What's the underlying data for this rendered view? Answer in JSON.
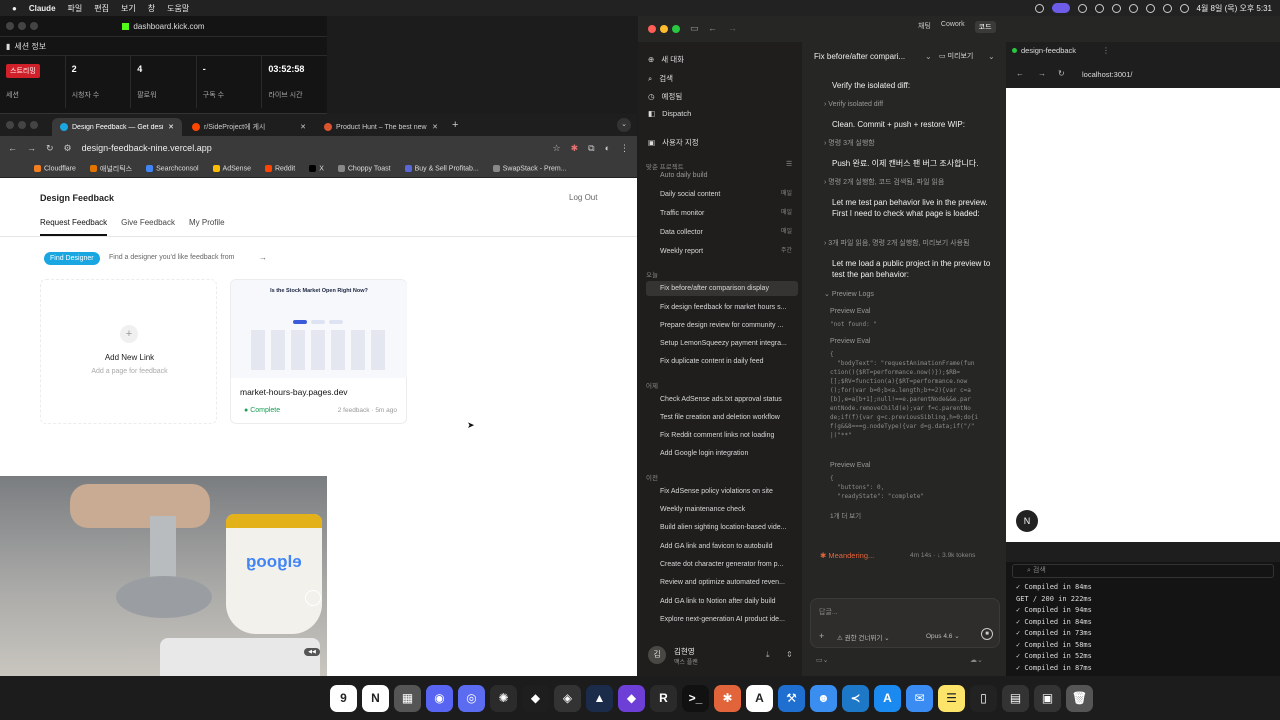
{
  "menubar": {
    "app": "Claude",
    "items": [
      "파일",
      "편집",
      "보기",
      "창",
      "도움말"
    ],
    "datetime": "4월 8일 (목) 오후 5:31"
  },
  "kick": {
    "url": "dashboard.kick.com",
    "header": "세션 정보",
    "live_badge": "스트리밍",
    "stats": [
      {
        "value": "",
        "label": "세션"
      },
      {
        "value": "2",
        "label": "시청자 수"
      },
      {
        "value": "4",
        "label": "팔로워"
      },
      {
        "value": "-",
        "label": "구독 수"
      },
      {
        "value": "03:52:58",
        "label": "라이브 시간"
      }
    ]
  },
  "chrome": {
    "tabs": [
      {
        "label": "Design Feedback — Get desi",
        "color": "#1aa6e0"
      },
      {
        "label": "r/SideProject에 게시",
        "color": "#ff4500"
      },
      {
        "label": "Product Hunt – The best new",
        "color": "#da552f"
      }
    ],
    "url": "design-feedback-nine.vercel.app",
    "bookmarks": [
      {
        "label": "Cloudflare",
        "color": "#f38020"
      },
      {
        "label": "애널리틱스",
        "color": "#e37400"
      },
      {
        "label": "Searchconsol",
        "color": "#4285f4"
      },
      {
        "label": "AdSense",
        "color": "#fbbc04"
      },
      {
        "label": "Reddit",
        "color": "#ff4500"
      },
      {
        "label": "X",
        "color": "#000000"
      },
      {
        "label": "Choppy Toast",
        "color": "#888888"
      },
      {
        "label": "Buy & Sell Profitab...",
        "color": "#5a67d8"
      },
      {
        "label": "SwapStack - Prem...",
        "color": "#888888"
      }
    ]
  },
  "page": {
    "brand": "Design Feedback",
    "logout": "Log Out",
    "nav": [
      "Request Feedback",
      "Give Feedback",
      "My Profile"
    ],
    "find_button": "Find Designer",
    "find_hint": "Find a designer you'd like feedback from",
    "find_arrow": "→",
    "add_card": {
      "title": "Add New Link",
      "subtitle": "Add a page for feedback"
    },
    "project_card": {
      "preview_title": "Is the Stock Market Open Right Now?",
      "name": "market-hours-bay.pages.dev",
      "status": "Complete",
      "meta": "2 feedback · 5m ago"
    }
  },
  "claude": {
    "mode_tabs": [
      "채팅",
      "Cowork",
      "코드"
    ],
    "sidebar": {
      "new_chat": "새 대화",
      "search": "검색",
      "scheduled": "예정됨",
      "dispatch": "Dispatch",
      "custom": "사용자 지정",
      "projects_label": "맞춘 프로젝트",
      "recurring": [
        {
          "title": "Auto daily build",
          "meta": ""
        },
        {
          "title": "Daily social content",
          "meta": "매일"
        },
        {
          "title": "Traffic monitor",
          "meta": "매일"
        },
        {
          "title": "Data collector",
          "meta": "매일"
        },
        {
          "title": "Weekly report",
          "meta": "주간"
        }
      ],
      "today_label": "오늘",
      "today": [
        "Fix before/after comparison display",
        "Fix design feedback for market hours s...",
        "Prepare design review for community ...",
        "Setup LemonSqueezy payment integra...",
        "Fix duplicate content in daily feed"
      ],
      "yesterday_label": "어제",
      "yesterday": [
        "Check AdSense ads.txt approval status",
        "Test file creation and deletion workflow",
        "Fix Reddit comment links not loading",
        "Add Google login integration"
      ],
      "older_label": "이전",
      "older": [
        "Fix AdSense policy violations on site",
        "Weekly maintenance check",
        "Build alien sighting location-based vide...",
        "Add GA link and favicon to autobuild",
        "Create dot character generator from p...",
        "Review and optimize automated reven...",
        "Add GA link to Notion after daily build",
        "Explore next-generation AI product ide..."
      ],
      "user_name": "김현영",
      "user_plan": "맥스 플랜",
      "user_initial": "김"
    },
    "chat": {
      "title": "Fix before/after compari...",
      "preview_btn": "미리보기",
      "lines": [
        {
          "kind": "bold",
          "text": "Verify the isolated diff:"
        },
        {
          "kind": "dim",
          "text": "Verify isolated diff"
        },
        {
          "kind": "bold",
          "text": "Clean. Commit + push + restore WIP:"
        },
        {
          "kind": "dim",
          "text": "명령 3개 실행함"
        },
        {
          "kind": "bold",
          "text": "Push 완료. 이제 캔버스 팬 버그 조사합니다."
        },
        {
          "kind": "dim",
          "text": "명령 2개 실행함, 코드 검색됨, 파일 읽음"
        },
        {
          "kind": "bold",
          "text": "Let me test pan behavior live in the preview. First I need to check what page is loaded:"
        },
        {
          "kind": "dim",
          "text": "3개 파일 읽음, 명령 2개 실행함, 미리보기 사용됨"
        },
        {
          "kind": "bold",
          "text": "Let me load a public project in the preview to test the pan behavior:"
        },
        {
          "kind": "dim",
          "text": "Preview Logs"
        }
      ],
      "eval1_label": "Preview Eval",
      "eval1_code": "\"not found: \"",
      "eval2_label": "Preview Eval",
      "eval2_code": "{\n  \"bodyText\": \"requestAnimationFrame(fun\nction(){$RT=performance.now()});$RB=\n[];$RV=function(a){$RT=performance.now\n();for(var b=0;b<a.length;b+=2){var c=a\n[b],e=a[b+1];null!==e.parentNode&&e.par\nentNode.removeChild(e);var f=c.parentNo\nde;if(f){var g=c.previousSibling,h=0;do{i\nf(g&&8===g.nodeType){var d=g.data;if(\"/\"\n|(\"**\"",
      "eval3_label": "Preview Eval",
      "eval3_code": "{\n  \"buttons\": 0,\n  \"readyState\": \"complete\"",
      "more": "1개 더 보기",
      "status": "Meandering...",
      "status_meta": "4m 14s · ↓ 3.9k tokens",
      "reply_placeholder": "답글...",
      "permission": "권한 건너뛰기",
      "model": "Opus 4.6"
    },
    "preview": {
      "tab": "design-feedback",
      "url": "localhost:3001/",
      "avatar_letter": "N",
      "console_search": "검색",
      "console": [
        "✓ Compiled in 84ms",
        "GET / 200 in 222ms",
        "✓ Compiled in 94ms",
        "✓ Compiled in 84ms",
        "✓ Compiled in 73ms",
        "✓ Compiled in 58ms",
        "✓ Compiled in 52ms",
        "✓ Compiled in 87ms"
      ]
    }
  },
  "dock": [
    {
      "name": "calendar",
      "glyph": "9",
      "color": "#ffffff"
    },
    {
      "name": "notion",
      "glyph": "N",
      "color": "#ffffff"
    },
    {
      "name": "calculator",
      "glyph": "▦",
      "color": "#555555"
    },
    {
      "name": "discord",
      "glyph": "◉",
      "color": "#5865f2"
    },
    {
      "name": "messenger",
      "glyph": "◎",
      "color": "#5b6cf0"
    },
    {
      "name": "chatgpt",
      "glyph": "✺",
      "color": "#2b2b2b"
    },
    {
      "name": "figma",
      "glyph": "◆",
      "color": "#1e1e1e"
    },
    {
      "name": "cube",
      "glyph": "◈",
      "color": "#333333"
    },
    {
      "name": "affinity",
      "glyph": "▲",
      "color": "#1b2b4a"
    },
    {
      "name": "obsidian",
      "glyph": "◆",
      "color": "#6d3fd6"
    },
    {
      "name": "r-app",
      "glyph": "R",
      "color": "#2a2a2a"
    },
    {
      "name": "terminal",
      "glyph": ">_",
      "color": "#111111"
    },
    {
      "name": "claude",
      "glyph": "✱",
      "color": "#e2643a"
    },
    {
      "name": "font",
      "glyph": "A",
      "color": "#ffffff"
    },
    {
      "name": "xcode",
      "glyph": "⚒",
      "color": "#1f6fd1"
    },
    {
      "name": "finder",
      "glyph": "☻",
      "color": "#3a8ef0"
    },
    {
      "name": "vscode",
      "glyph": "≺",
      "color": "#1e78c8"
    },
    {
      "name": "appstore",
      "glyph": "A",
      "color": "#1b8af0"
    },
    {
      "name": "mail",
      "glyph": "✉",
      "color": "#3b8cf2"
    },
    {
      "name": "notes",
      "glyph": "☰",
      "color": "#fce36a"
    },
    {
      "name": "phone",
      "glyph": "▯",
      "color": "#222222"
    },
    {
      "name": "screens",
      "glyph": "▤",
      "color": "#333333"
    },
    {
      "name": "desktop",
      "glyph": "▣",
      "color": "#333333"
    },
    {
      "name": "trash",
      "glyph": "🗑",
      "color": "#555555"
    }
  ]
}
